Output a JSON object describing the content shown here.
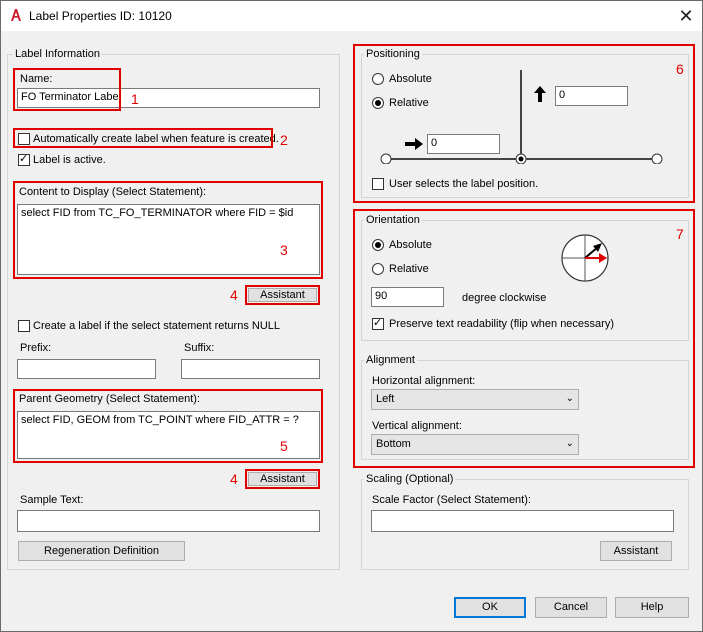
{
  "window": {
    "title": "Label Properties ID: 10120",
    "close": "✕"
  },
  "label_info": {
    "group_title": "Label Information",
    "name_label": "Name:",
    "name_value": "FO Terminator Label",
    "auto_create_label": "Automatically create label when feature is created.",
    "auto_create_checked": false,
    "is_active_label": "Label is active.",
    "is_active_checked": true,
    "content_label": "Content to Display (Select Statement):",
    "content_value": "select FID from TC_FO_TERMINATOR where FID = $id",
    "assistant_label": "Assistant",
    "null_label": "Create a label if the select statement returns NULL",
    "null_checked": false,
    "prefix_label": "Prefix:",
    "prefix_value": "",
    "suffix_label": "Suffix:",
    "suffix_value": "",
    "parent_label": "Parent Geometry (Select Statement):",
    "parent_value": "select FID, GEOM from TC_POINT where FID_ATTR = ?",
    "assistant2_label": "Assistant",
    "sample_label": "Sample Text:",
    "sample_value": "",
    "regen_label": "Regeneration Definition"
  },
  "positioning": {
    "group_title": "Positioning",
    "absolute": "Absolute",
    "relative": "Relative",
    "selected": "relative",
    "y_value": "0",
    "x_value": "0",
    "user_selects_label": "User selects the label position.",
    "user_selects_checked": false
  },
  "orientation": {
    "group_title": "Orientation",
    "absolute": "Absolute",
    "relative": "Relative",
    "selected": "absolute",
    "degree_value": "90",
    "degree_label": "degree clockwise",
    "preserve_label": "Preserve text readability (flip when necessary)",
    "preserve_checked": true
  },
  "alignment": {
    "group_title": "Alignment",
    "horizontal_label": "Horizontal alignment:",
    "horizontal_value": "Left",
    "vertical_label": "Vertical alignment:",
    "vertical_value": "Bottom"
  },
  "scaling": {
    "group_title": "Scaling (Optional)",
    "scale_label": "Scale Factor (Select Statement):",
    "scale_value": "",
    "assistant_label": "Assistant"
  },
  "footer": {
    "ok": "OK",
    "cancel": "Cancel",
    "help": "Help"
  },
  "callouts": {
    "n1": "1",
    "n2": "2",
    "n3": "3",
    "n4a": "4",
    "n4b": "4",
    "n5": "5",
    "n6": "6",
    "n7": "7"
  },
  "colors": {
    "callout": "#e00000",
    "focus": "#0078d7"
  }
}
